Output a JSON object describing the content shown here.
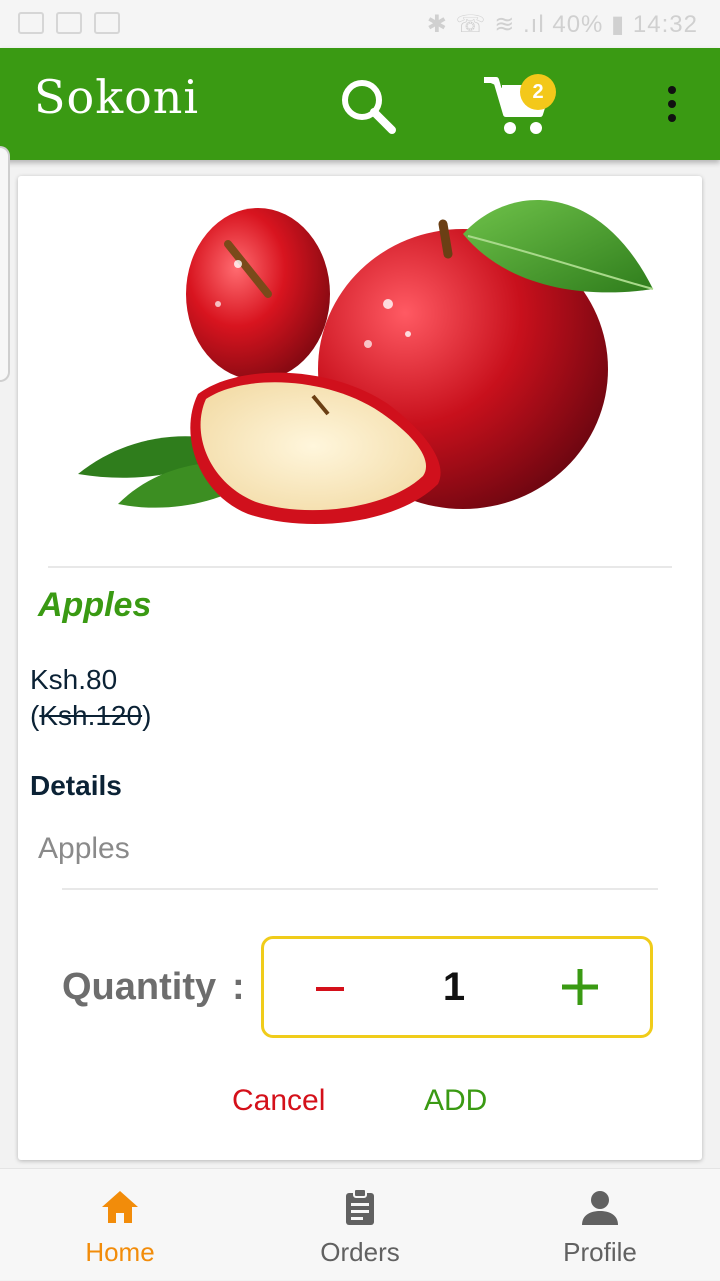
{
  "status_bar": {
    "right_text": "✱ ☏ ≋ .ıl 40% ▮ 14:32"
  },
  "app_bar": {
    "title": "Sokoni",
    "cart_count": "2"
  },
  "product": {
    "name": "Apples",
    "price": "Ksh.80",
    "old_price_open": "(",
    "old_price": "Ksh.120",
    "old_price_close": ")",
    "details_label": "Details",
    "details_text": "Apples"
  },
  "quantity": {
    "label": "Quantity",
    "colon": ":",
    "value": "1"
  },
  "actions": {
    "cancel_label": "Cancel",
    "add_label": "ADD"
  },
  "bottom_nav": {
    "items": [
      {
        "label": "Home",
        "icon": "home-icon",
        "active": true
      },
      {
        "label": "Orders",
        "icon": "clipboard-icon",
        "active": false
      },
      {
        "label": "Profile",
        "icon": "person-icon",
        "active": false
      }
    ]
  },
  "colors": {
    "primary": "#3a9a13",
    "accent_yellow": "#f0cc1a",
    "cancel_red": "#d4101a",
    "nav_active": "#f28c0a",
    "nav_inactive": "#616161"
  }
}
